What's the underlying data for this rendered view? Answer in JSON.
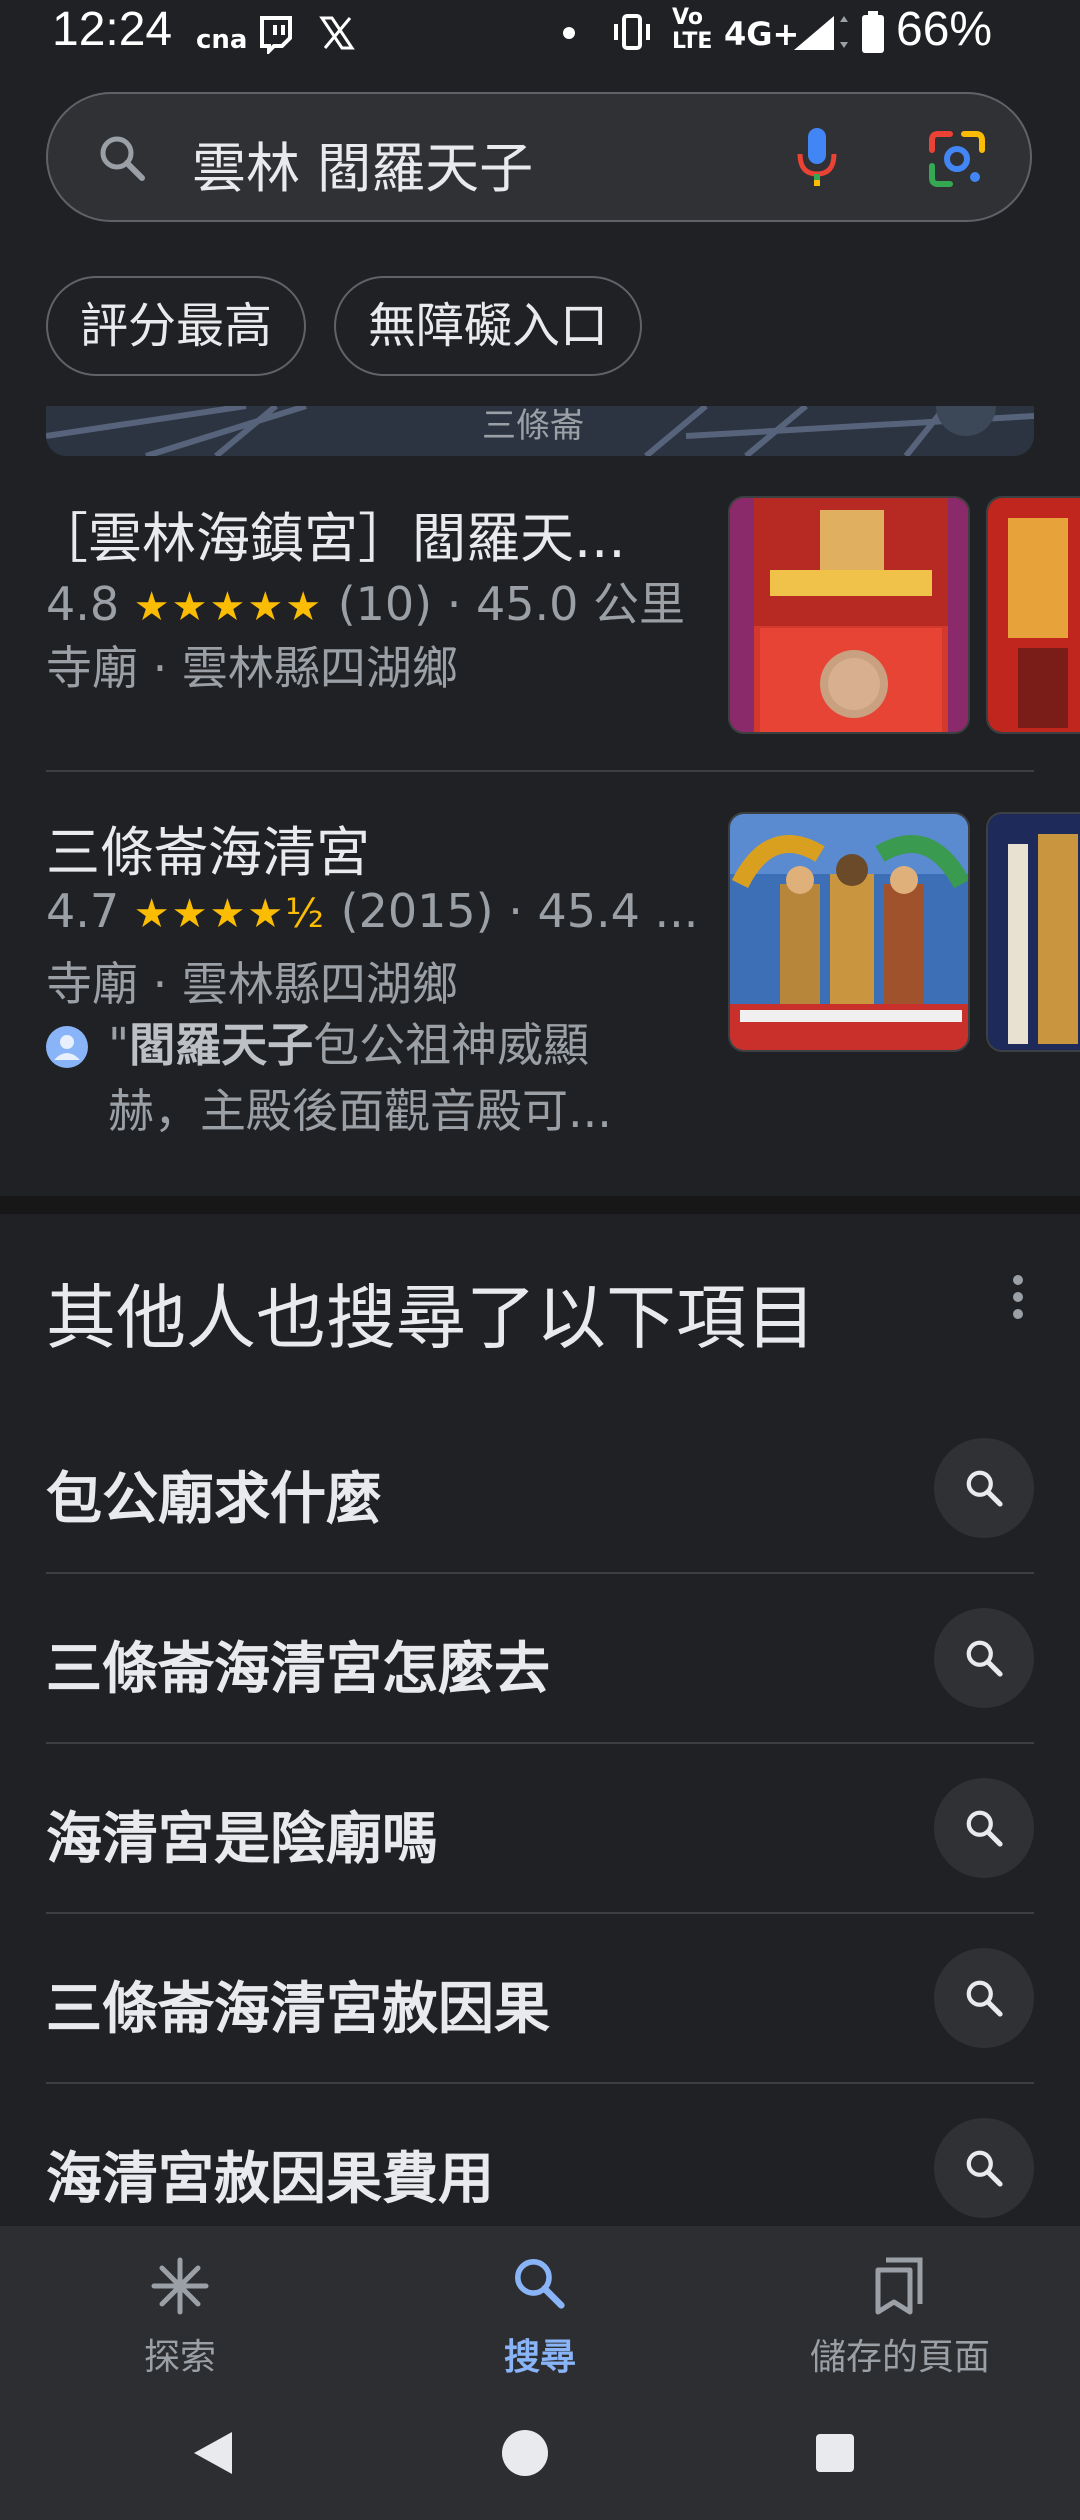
{
  "status_bar": {
    "time": "12:24",
    "network": "4G+",
    "volte": "Vo LTE",
    "battery": "66%"
  },
  "search": {
    "query": "雲林 閻羅天子"
  },
  "chips": [
    {
      "label": "評分最高"
    },
    {
      "label": "無障礙入口"
    }
  ],
  "map_label": "三條崙",
  "results": [
    {
      "title": "［雲林海鎮宮］閻羅天...",
      "rating": "4.8",
      "stars": "★★★★★",
      "count_distance": "(10) · 45.0 公里",
      "meta": "寺廟 · 雲林縣四湖鄉"
    },
    {
      "title": "三條崙海清宮",
      "rating": "4.7",
      "stars": "★★★★½",
      "count_distance": "(2015) · 45.4 ...",
      "meta": "寺廟 · 雲林縣四湖鄉",
      "review_bold": "閻羅天子",
      "review_quote": "\"",
      "review_rest": "包公祖神威顯赫，主殿後面觀音殿可..."
    }
  ],
  "related": {
    "title": "其他人也搜尋了以下項目",
    "items": [
      {
        "label": "包公廟求什麼"
      },
      {
        "label": "三條崙海清宮怎麼去"
      },
      {
        "label": "海清宮是陰廟嗎"
      },
      {
        "label": "三條崙海清宮赦因果"
      },
      {
        "label": "海清宮赦因果費用"
      }
    ]
  },
  "bottom_nav": {
    "explore": "探索",
    "search": "搜尋",
    "saved": "儲存的頁面"
  },
  "colors": {
    "background": "#202124",
    "accent": "#8ab4f8",
    "star": "#fbbc04"
  },
  "icons": [
    "search-icon",
    "mic-icon",
    "lens-icon",
    "more-vert-icon",
    "explore-icon",
    "bookmarks-icon",
    "back-icon",
    "home-icon",
    "recents-icon"
  ]
}
